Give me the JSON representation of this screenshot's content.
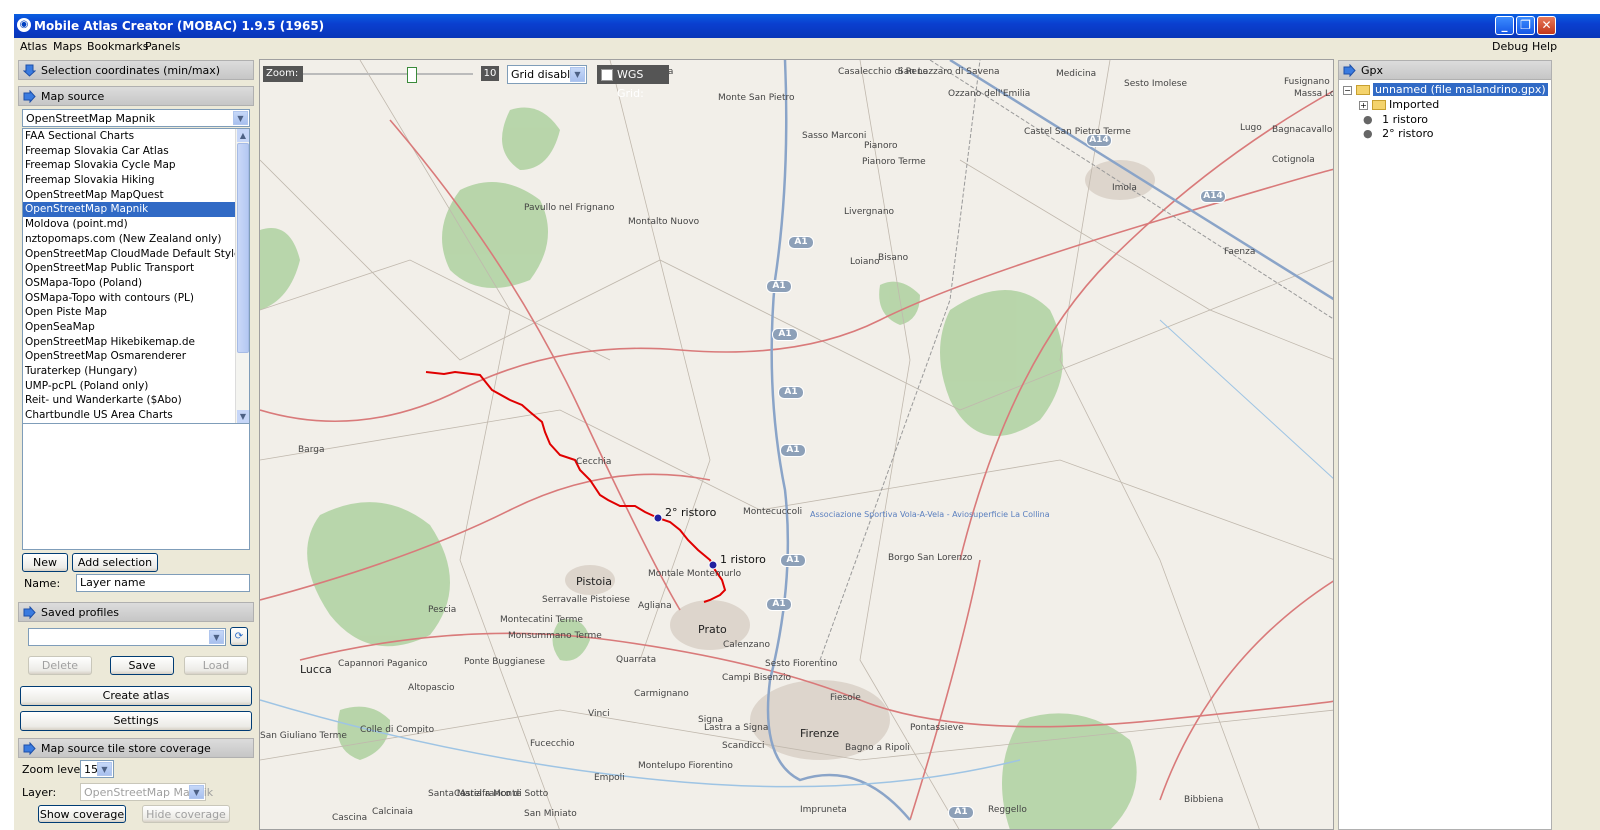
{
  "window": {
    "title": "Mobile Atlas Creator (MOBAC) 1.9.5 (1965)"
  },
  "menu": {
    "left": [
      "Atlas",
      "Maps",
      "Bookmarks",
      "Panels"
    ],
    "right": [
      "Debug",
      "Help"
    ]
  },
  "selection_panel": {
    "title": "Selection coordinates (min/max)"
  },
  "map_source_panel": {
    "title": "Map source",
    "selected": "OpenStreetMap Mapnik",
    "items": [
      "FAA Sectional Charts",
      "Freemap Slovakia Car Atlas",
      "Freemap Slovakia Cycle Map",
      "Freemap Slovakia Hiking",
      "OpenStreetMap MapQuest",
      "OpenStreetMap Mapnik",
      "Moldova (point.md)",
      "nztopomaps.com (New Zealand only)",
      "OpenStreetMap CloudMade Default Style",
      "OpenStreetMap Public Transport",
      "OSMapa-Topo (Poland)",
      "OSMapa-Topo with contours (PL)",
      "Open Piste Map",
      "OpenSeaMap",
      "OpenStreetMap Hikebikemap.de",
      "OpenStreetMap Osmarenderer",
      "Turaterkep (Hungary)",
      "UMP-pcPL (Poland only)",
      "Reit- und Wanderkarte ($Abo)",
      "Chartbundle US Area Charts"
    ],
    "selected_index": 5
  },
  "layer": {
    "new_label": "New",
    "add_selection_label": "Add selection",
    "name_label": "Name:",
    "name_value": "Layer name"
  },
  "profiles": {
    "title": "Saved profiles",
    "value": "",
    "delete_label": "Delete",
    "save_label": "Save",
    "load_label": "Load"
  },
  "actions": {
    "create_atlas": "Create atlas",
    "settings": "Settings"
  },
  "coverage": {
    "title": "Map source tile store coverage",
    "zoom_label": "Zoom level:",
    "zoom_value": "15",
    "layer_label": "Layer:",
    "layer_value": "OpenStreetMap Mapnik",
    "show_label": "Show coverage",
    "hide_label": "Hide coverage"
  },
  "map_toolbar": {
    "zoom_label": "Zoom:",
    "zoom_value": "10",
    "zoom_level": 10,
    "grid_value": "Grid disabled",
    "wgs_label": "WGS Grid:"
  },
  "map": {
    "places": [
      "Barga",
      "Pescia",
      "Lucca",
      "Pistoia",
      "Prato",
      "Firenze",
      "Montecuccoli",
      "Montale Montemurlo",
      "Agliana",
      "Serravalle Pistoiese",
      "Montecatini Terme",
      "Monsummano Terme",
      "Ponte Buggianese",
      "Capannori Paganico",
      "Altopascio",
      "Quarrata",
      "Carmignano",
      "Calenzano",
      "Sesto Fiorentino",
      "Campi Bisenzio",
      "Signa",
      "Lastra a Signa",
      "Scandicci",
      "Vinci",
      "Fucecchio",
      "Empoli",
      "Montelupo Fiorentino",
      "San Miniato",
      "Santa Maria a Monte",
      "Castelfranco di Sotto",
      "Calcinaia",
      "Cascina",
      "Colle di Compito",
      "San Giuliano Terme",
      "Impruneta",
      "Bagno a Ripoli",
      "Pontassieve",
      "Fiesole",
      "Reggello",
      "Bibbiena",
      "Borgo San Lorenzo",
      "Faenza",
      "Imola",
      "Castel San Pietro Terme",
      "Lugo",
      "Bagnacavallo",
      "Cotignola",
      "Fusignano",
      "Massa Lombarda",
      "Medicina",
      "Sesto Imolese",
      "Ozzano dell'Emilia",
      "San Lazzaro di Savena",
      "Casalecchio di Reno",
      "Vignola",
      "Monte San Pietro",
      "Sasso Marconi",
      "Pianoro",
      "Pianoro Terme",
      "Pavullo nel Frignano",
      "Montalto Nuovo",
      "Livergnano",
      "Loiano",
      "Bisano",
      "Cecchia"
    ],
    "highways": [
      "A1",
      "A1",
      "A1",
      "A1",
      "A1",
      "A1",
      "A1",
      "A14",
      "A14",
      "A1"
    ],
    "club_label": "Associazione Sportiva Vola-A-Vela - Aviosuperficie La Collina",
    "waypoints": [
      "2° ristoro",
      "1 ristoro"
    ]
  },
  "gpx_panel": {
    "title": "Gpx",
    "root": "unnamed (file malandrino.gpx)",
    "folder": "Imported",
    "points": [
      "1 ristoro",
      "2° ristoro"
    ]
  },
  "colors": {
    "accent": "#316ac5",
    "track": "#e00000",
    "titlebar": "#0a4fd8"
  }
}
